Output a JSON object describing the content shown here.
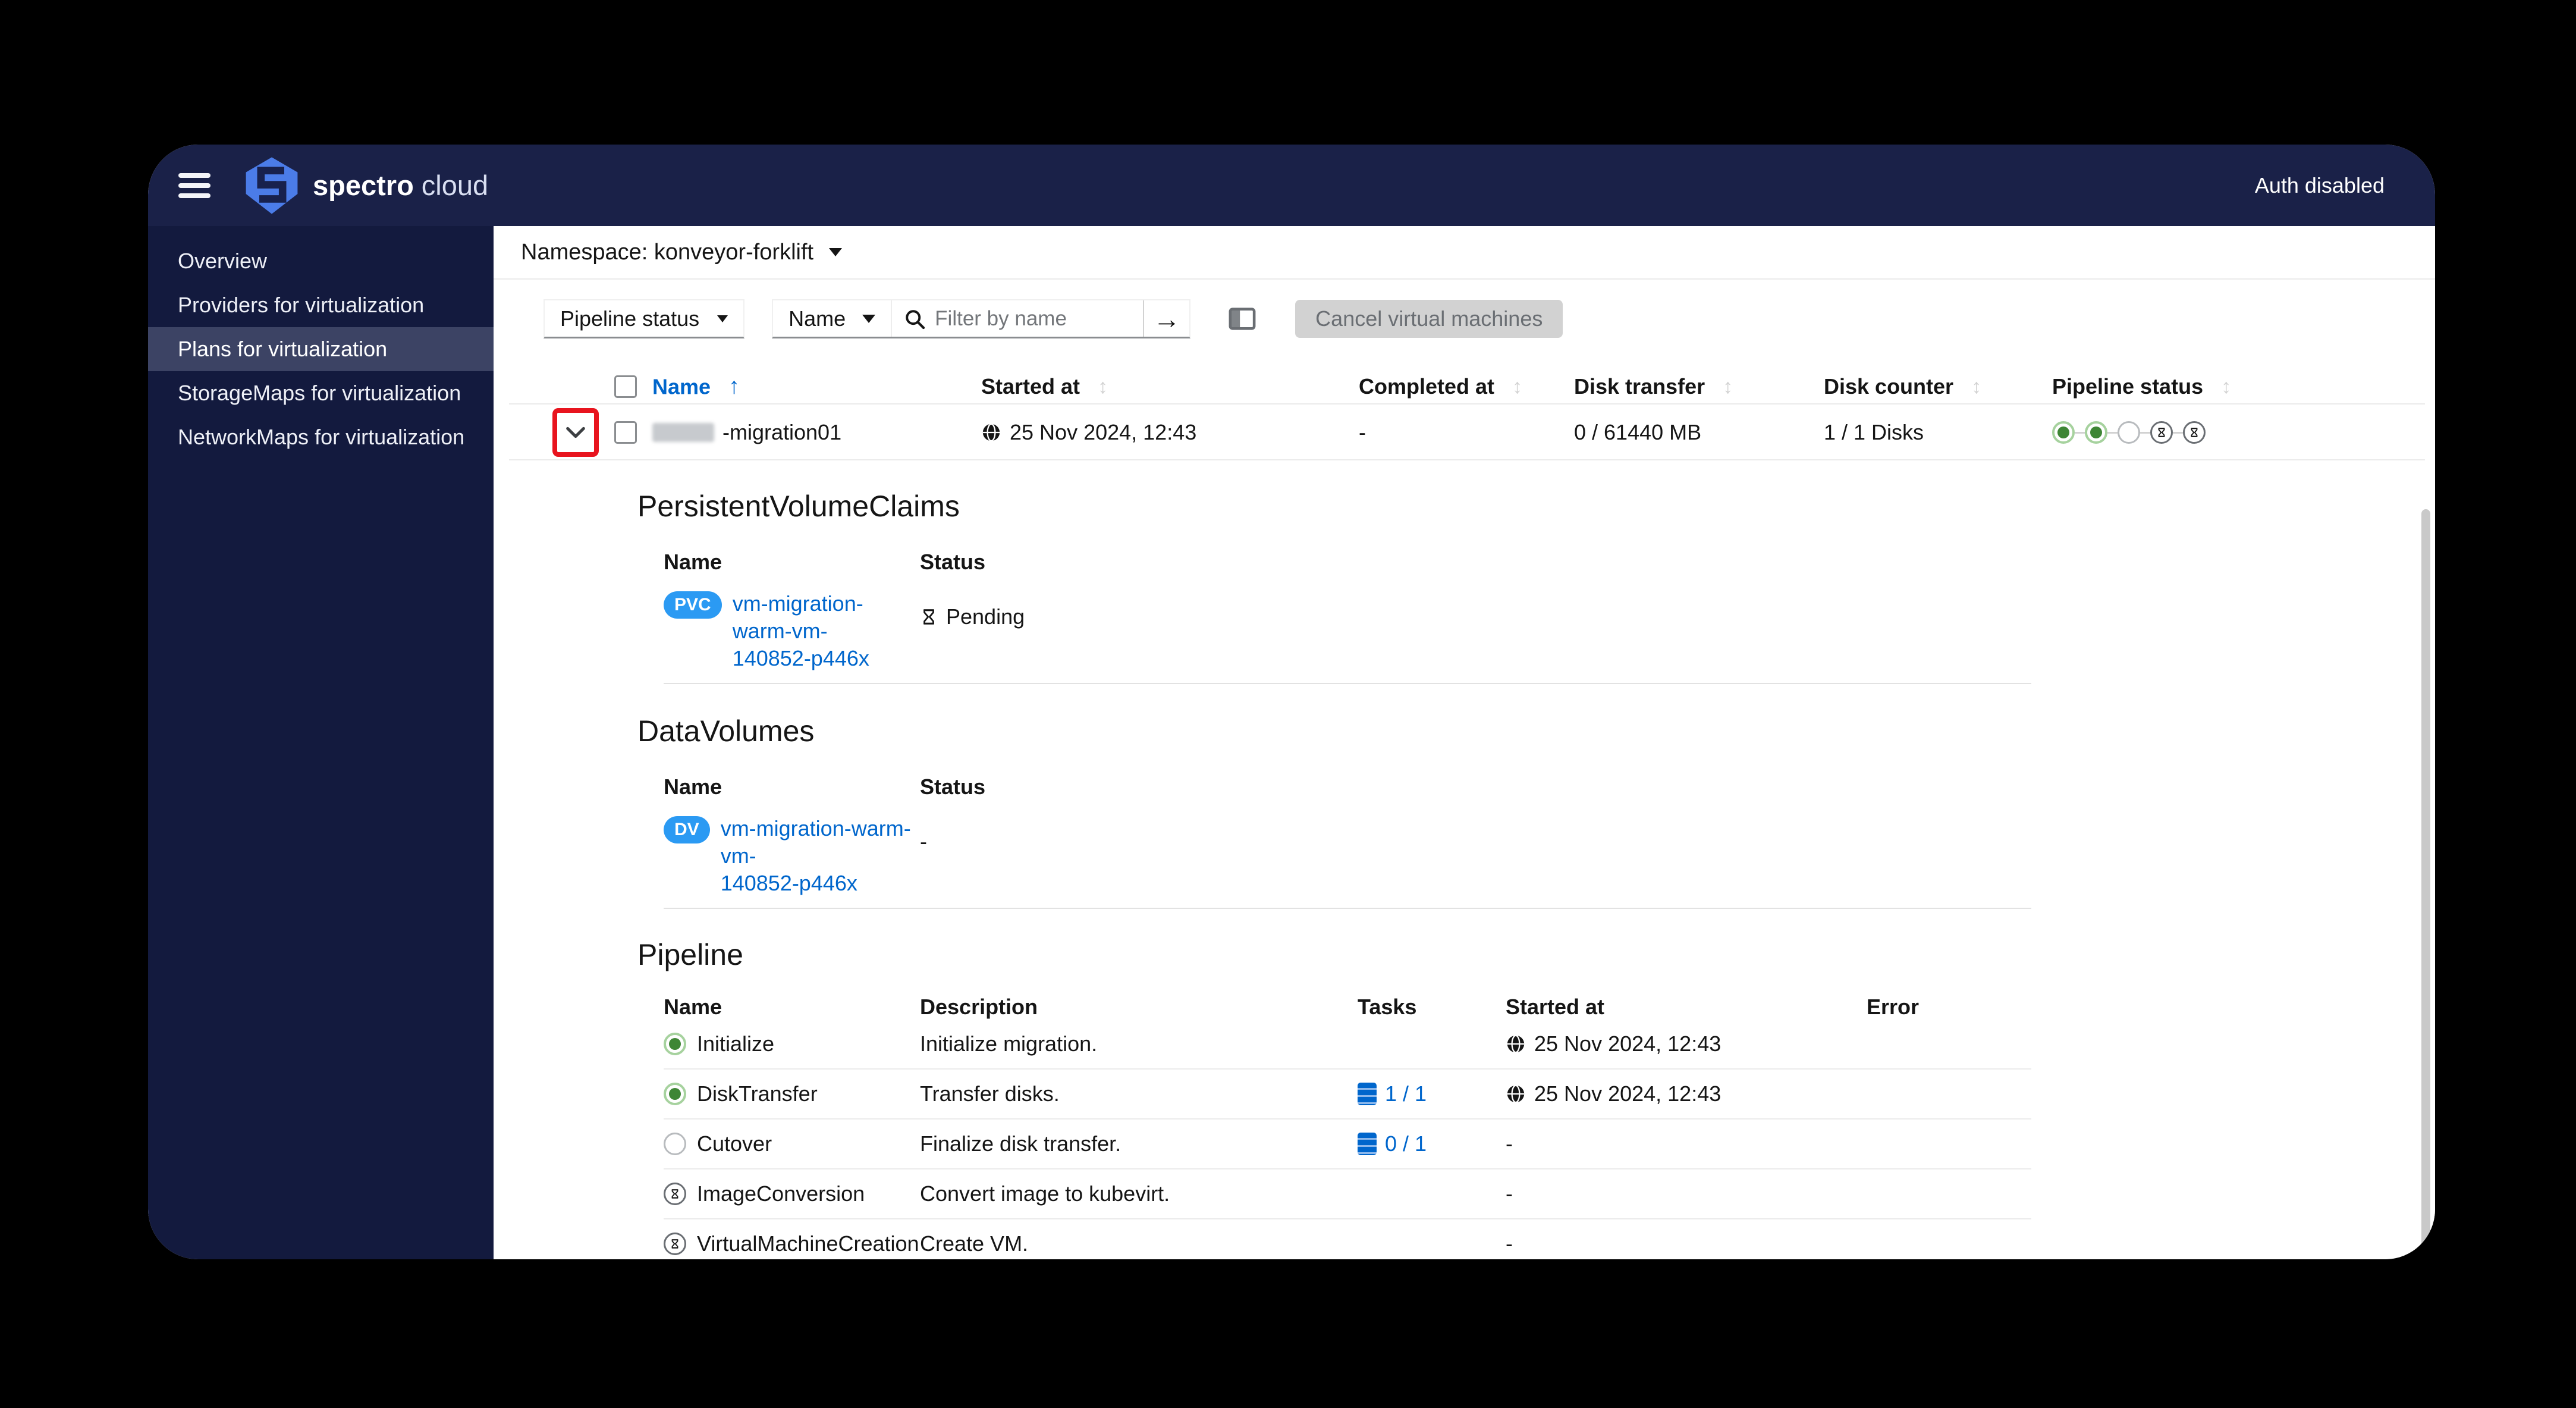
{
  "window": {
    "brand_primary": "spectro",
    "brand_secondary": "cloud",
    "auth_status": "Auth disabled"
  },
  "sidebar": {
    "items": [
      {
        "label": "Overview",
        "active": false
      },
      {
        "label": "Providers for virtualization",
        "active": false
      },
      {
        "label": "Plans for virtualization",
        "active": true
      },
      {
        "label": "StorageMaps for virtualization",
        "active": false
      },
      {
        "label": "NetworkMaps for virtualization",
        "active": false
      }
    ]
  },
  "content": {
    "namespace_bar": {
      "label": "Namespace: konveyor-forklift"
    },
    "toolbar": {
      "pipeline_status_filter_label": "Pipeline status",
      "attribute_filter_label": "Name",
      "search_placeholder": "Filter by name",
      "submit_arrow": "→",
      "cancel_button_label": "Cancel virtual machines"
    },
    "plans_table": {
      "columns": [
        "Name",
        "Started at",
        "Completed at",
        "Disk transfer",
        "Disk counter",
        "Pipeline status"
      ],
      "sorted_by": "Name ascending",
      "sort_arrow": "↑",
      "sort_placeholder_icon": "↕",
      "row": {
        "name": "-migration01",
        "name_prefix_redacted": true,
        "started_at": "25 Nov 2024, 12:43",
        "completed_at": "-",
        "disk_transfer": "0 / 61440 MB",
        "disk_counter": "1 / 1 Disks",
        "pipeline_steps": [
          "success",
          "success",
          "empty",
          "pending",
          "pending"
        ],
        "selected": false,
        "expanded": true
      }
    },
    "details": {
      "pvc": {
        "title": "PersistentVolumeClaims",
        "col_name": "Name",
        "col_status": "Status",
        "row": {
          "badge": "PVC",
          "name_line1": "vm-migration-warm-vm-",
          "name_line2": "140852-p446x",
          "status": "Pending"
        }
      },
      "dv": {
        "title": "DataVolumes",
        "col_name": "Name",
        "col_status": "Status",
        "row": {
          "badge": "DV",
          "name_line1": "vm-migration-warm-vm-",
          "name_line2": "140852-p446x",
          "status": "-"
        }
      },
      "pipeline": {
        "title": "Pipeline",
        "columns": [
          "Name",
          "Description",
          "Tasks",
          "Started at",
          "Error"
        ],
        "rows": [
          {
            "name": "Initialize",
            "status": "success",
            "description": "Initialize migration.",
            "tasks": "",
            "started_at": "25 Nov 2024, 12:43",
            "error": ""
          },
          {
            "name": "DiskTransfer",
            "status": "success",
            "description": "Transfer disks.",
            "tasks": "1 / 1",
            "started_at": "25 Nov 2024, 12:43",
            "error": ""
          },
          {
            "name": "Cutover",
            "status": "empty",
            "description": "Finalize disk transfer.",
            "tasks": "0 / 1",
            "started_at": "-",
            "error": ""
          },
          {
            "name": "ImageConversion",
            "status": "pending",
            "description": "Convert image to kubevirt.",
            "tasks": "",
            "started_at": "-",
            "error": ""
          },
          {
            "name": "VirtualMachineCreation",
            "status": "pending",
            "description": "Create VM.",
            "tasks": "",
            "started_at": "-",
            "error": ""
          }
        ]
      }
    }
  },
  "colors": {
    "header_navy": "#1a2148",
    "sidebar_navy": "#131a3e",
    "active_item": "#3c4364",
    "link_blue": "#0066cc",
    "badge_blue": "#2b9af3",
    "success_green": "#3e8635",
    "success_ring": "#a6d29e",
    "disabled_gray": "#d2d2d2",
    "border_gray": "#ebebeb",
    "annotation_red": "#e8141e"
  },
  "icons": {
    "menu": "hamburger",
    "brand": "spectro-cloud-shield",
    "namespace_caret": "caret-down",
    "search": "magnifier",
    "submit": "arrow-right",
    "columns": "table-columns",
    "row_expand": "chevron-down",
    "date": "globe",
    "pending": "hourglass",
    "tasks": "vm-list",
    "sort": "up-down-arrows"
  }
}
